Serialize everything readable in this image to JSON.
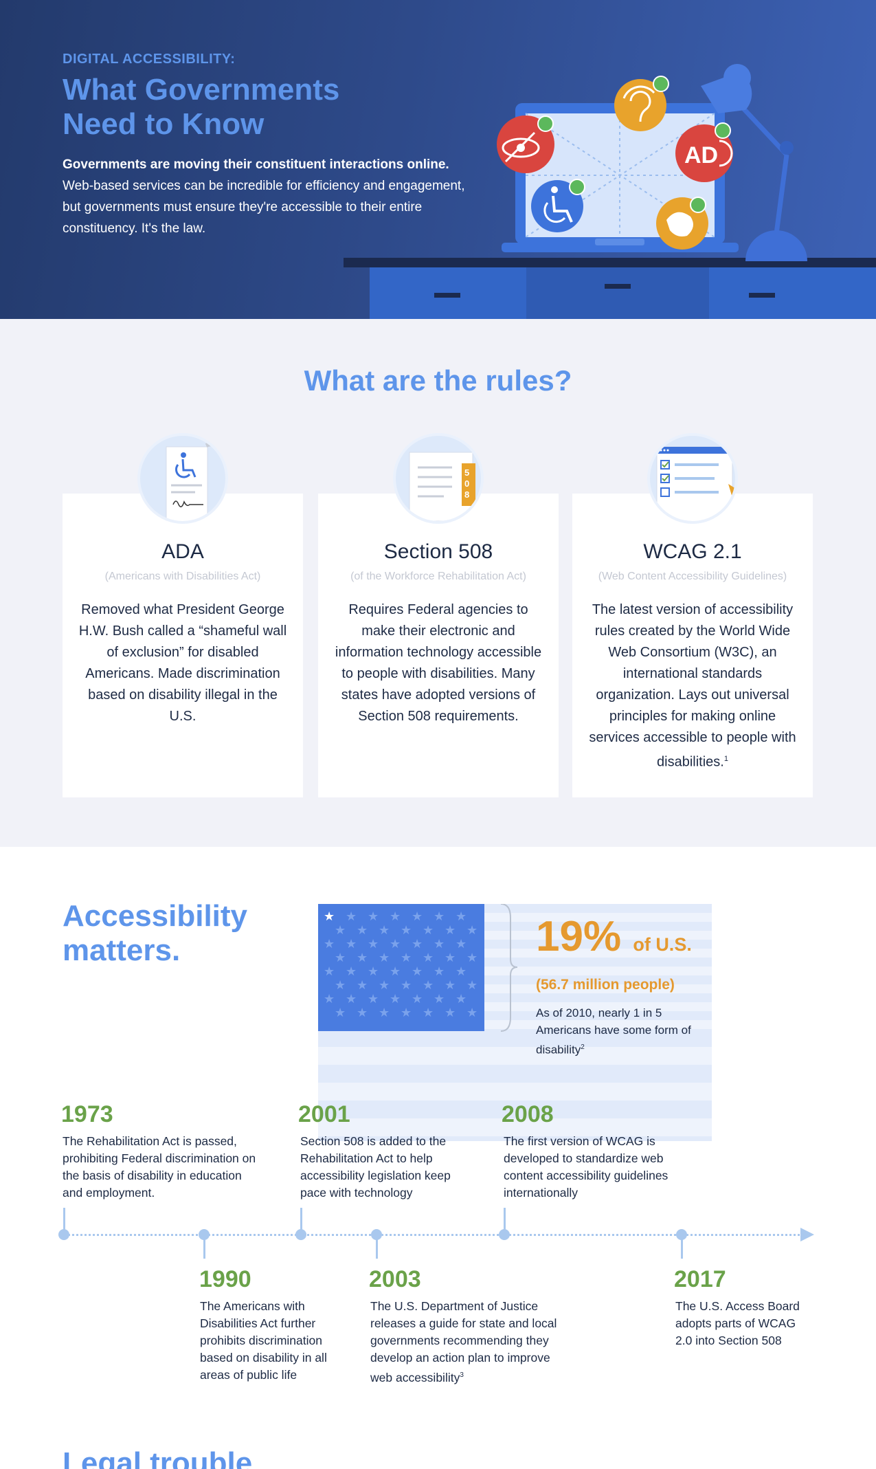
{
  "hero": {
    "eyebrow": "DIGITAL ACCESSIBILITY:",
    "title": "What Governments Need to Know",
    "lead_bold": "Governments are moving their constituent interactions online.",
    "lead_rest": "Web-based services can be incredible for efficiency and engagement, but governments must ensure they're accessible to their entire constituency. It's the law."
  },
  "rules": {
    "title": "What are the rules?",
    "cards": [
      {
        "title": "ADA",
        "subtitle": "(Americans with Disabilities Act)",
        "body": "Removed what President George H.W. Bush called a “shameful wall of exclusion” for disabled Americans. Made discrimination based on disability illegal in the U.S.",
        "icon": "wheelchair-document-icon"
      },
      {
        "title": "Section 508",
        "subtitle": "(of the Workforce Rehabilitation Act)",
        "body": "Requires Federal agencies to make their electronic and information technology accessible to people with disabilities. Many states have adopted versions of Section 508 requirements.",
        "icon": "section-508-document-icon",
        "icon_tab": "508"
      },
      {
        "title": "WCAG 2.1",
        "subtitle": "(Web Content Accessibility Guidelines)",
        "body": "The latest version of accessibility rules created by the World Wide Web Consortium (W3C), an international standards organization. Lays out universal principles for making online services accessible to people with disabilities.",
        "footnote": "1",
        "icon": "checklist-browser-icon"
      }
    ]
  },
  "matters": {
    "title": "Accessibility matters.",
    "stat_value": "19%",
    "stat_suffix": "of U.S.",
    "stat_people": "(56.7 million people)",
    "stat_text": "As of 2010, nearly 1 in 5 Americans have some form of disability",
    "stat_footnote": "2"
  },
  "timeline": [
    {
      "year": "1973",
      "text": "The Rehabilitation Act is passed, prohibiting Federal discrimination on the basis of disability in education and employment."
    },
    {
      "year": "1990",
      "text": "The Americans with Disabilities Act further prohibits discrimination based on disability in all areas of public life"
    },
    {
      "year": "2001",
      "text": "Section 508 is added to the Rehabilitation Act to help accessibility legislation keep pace with technology"
    },
    {
      "year": "2003",
      "text": "The U.S. Department of Justice releases a guide for state and local governments recommending they develop an action plan to improve web accessibility",
      "footnote": "3"
    },
    {
      "year": "2008",
      "text": "The first version of WCAG is developed to standardize web content accessibility guidelines internationally"
    },
    {
      "year": "2017",
      "text": "The U.S. Access Board adopts parts of WCAG 2.0 into Section 508"
    }
  ],
  "legal": {
    "title": "Legal trouble"
  },
  "icons": {
    "eye": "eye-slash-icon",
    "hearing": "hearing-icon",
    "audio_description": "audio-description-icon",
    "wheelchair": "wheelchair-icon",
    "sign_language": "sign-language-icon",
    "lamp": "desk-lamp-icon",
    "laptop": "laptop-icon",
    "flag": "us-flag-icon"
  },
  "colors": {
    "accent_blue": "#5e95ea",
    "accent_orange": "#e5992f",
    "accent_green": "#6aa249",
    "navy": "#1d2a44"
  }
}
